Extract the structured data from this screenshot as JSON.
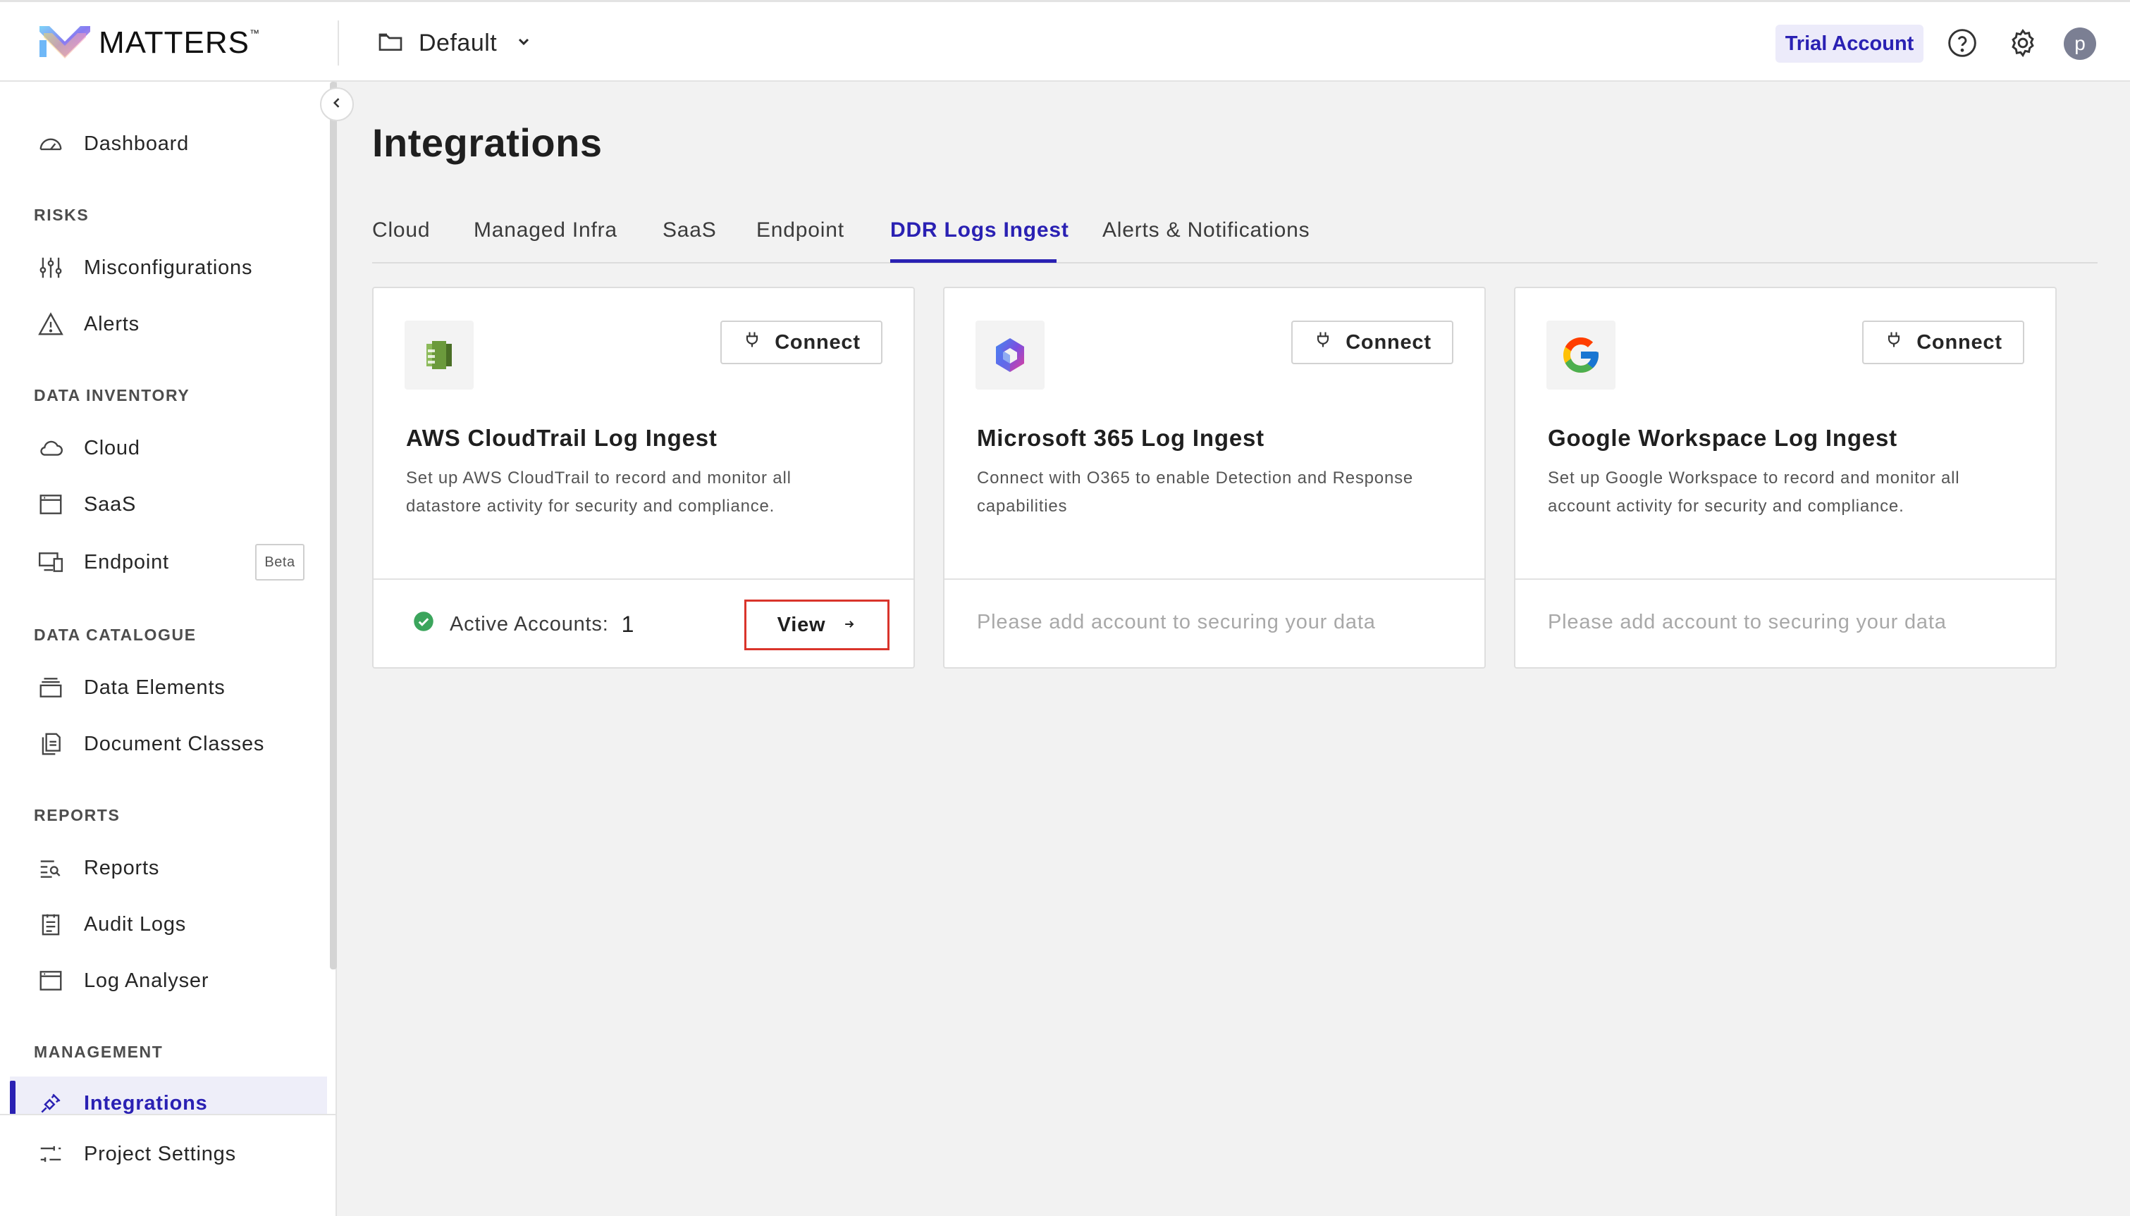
{
  "app": {
    "brand": "MATTERS",
    "trademark": "™"
  },
  "header": {
    "project_name": "Default",
    "trial_label": "Trial Account",
    "avatar_initial": "p"
  },
  "sidebar": {
    "dashboard": "Dashboard",
    "sections": {
      "risks": "RISKS",
      "data_inventory": "DATA INVENTORY",
      "data_catalogue": "DATA CATALOGUE",
      "reports": "REPORTS",
      "management": "MANAGEMENT"
    },
    "items": {
      "misconfigurations": "Misconfigurations",
      "alerts": "Alerts",
      "cloud": "Cloud",
      "saas": "SaaS",
      "endpoint": "Endpoint",
      "endpoint_badge": "Beta",
      "data_elements": "Data Elements",
      "document_classes": "Document Classes",
      "reports": "Reports",
      "audit_logs": "Audit Logs",
      "log_analyser": "Log Analyser",
      "integrations": "Integrations",
      "project_settings": "Project Settings"
    },
    "active_item": "Integrations"
  },
  "main": {
    "title": "Integrations",
    "tabs": [
      {
        "label": "Cloud"
      },
      {
        "label": "Managed Infra"
      },
      {
        "label": "SaaS"
      },
      {
        "label": "Endpoint"
      },
      {
        "label": "DDR Logs Ingest"
      },
      {
        "label": "Alerts & Notifications"
      }
    ],
    "active_tab": "DDR Logs Ingest",
    "cards": [
      {
        "icon": "aws-cloudtrail-icon",
        "connect_label": "Connect",
        "title": "AWS CloudTrail Log Ingest",
        "description_line1": "Set up AWS CloudTrail to record and monitor all",
        "description_line2": "datastore activity for security and compliance.",
        "active_accounts_label": "Active Accounts:",
        "active_accounts_count": "1",
        "view_label": "View"
      },
      {
        "icon": "microsoft-365-icon",
        "connect_label": "Connect",
        "title": "Microsoft 365 Log Ingest",
        "description_line1": "Connect with O365 to enable Detection and Response",
        "description_line2": "capabilities",
        "footer_message": "Please add account to securing your data"
      },
      {
        "icon": "google-icon",
        "connect_label": "Connect",
        "title": "Google Workspace Log Ingest",
        "description_line1": "Set up Google Workspace to record and monitor all",
        "description_line2": "account activity for security and compliance.",
        "footer_message": "Please add account to securing your data"
      }
    ]
  },
  "colors": {
    "accent": "#2a21b3",
    "highlight_border": "#d9342b",
    "success": "#3ba55c"
  }
}
